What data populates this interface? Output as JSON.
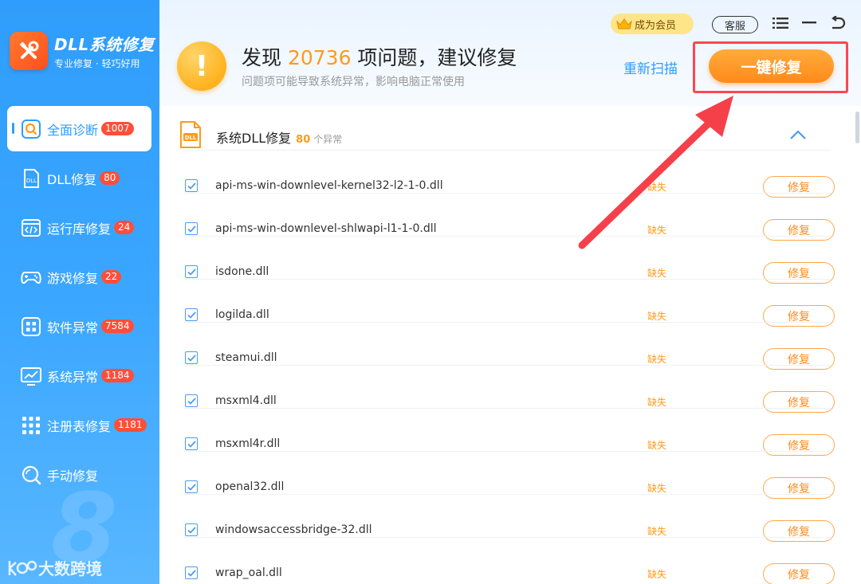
{
  "app": {
    "title": "DLL系统修复",
    "subtitle": "专业修复 · 轻巧好用"
  },
  "sidebar": {
    "items": [
      {
        "label": "全面诊断",
        "badge": "1007",
        "icon": "search-icon",
        "active": true
      },
      {
        "label": "DLL修复",
        "badge": "80",
        "icon": "dll-file-icon"
      },
      {
        "label": "运行库修复",
        "badge": "24",
        "icon": "code-window-icon"
      },
      {
        "label": "游戏修复",
        "badge": "22",
        "icon": "gamepad-icon"
      },
      {
        "label": "软件异常",
        "badge": "7584",
        "icon": "apps-grid-icon"
      },
      {
        "label": "系统异常",
        "badge": "1184",
        "icon": "monitor-chart-icon"
      },
      {
        "label": "注册表修复",
        "badge": "1181",
        "icon": "registry-grid-icon"
      },
      {
        "label": "手动修复",
        "badge": "",
        "icon": "magnifier-icon"
      }
    ],
    "watermark": "大数跨境",
    "background_numeral": "8"
  },
  "header": {
    "title_prefix": "发现 ",
    "issue_count": "20736",
    "title_suffix": " 项问题，建议修复",
    "subtitle": "问题项可能导致系统异常，影响电脑正常使用",
    "rescan_label": "重新扫描",
    "fix_all_label": "一键修复",
    "member_label": "成为会员",
    "service_label": "客服"
  },
  "section": {
    "title": "系统DLL修复",
    "count": "80",
    "unit": "个异常"
  },
  "rows": [
    {
      "name": "api-ms-win-downlevel-kernel32-l2-1-0.dll",
      "status": "缺失",
      "action": "修复"
    },
    {
      "name": "api-ms-win-downlevel-shlwapi-l1-1-0.dll",
      "status": "缺失",
      "action": "修复"
    },
    {
      "name": "isdone.dll",
      "status": "缺失",
      "action": "修复"
    },
    {
      "name": "logilda.dll",
      "status": "缺失",
      "action": "修复"
    },
    {
      "name": "steamui.dll",
      "status": "缺失",
      "action": "修复"
    },
    {
      "name": "msxml4.dll",
      "status": "缺失",
      "action": "修复"
    },
    {
      "name": "msxml4r.dll",
      "status": "缺失",
      "action": "修复"
    },
    {
      "name": "openal32.dll",
      "status": "缺失",
      "action": "修复"
    },
    {
      "name": "windowsaccessbridge-32.dll",
      "status": "缺失",
      "action": "修复"
    },
    {
      "name": "wrap_oal.dll",
      "status": "缺失",
      "action": "修复"
    }
  ],
  "colors": {
    "primary": "#2f9dfb",
    "accent": "#ff9a1a",
    "badge": "#ff4e3a",
    "highlight": "#ff4650"
  }
}
